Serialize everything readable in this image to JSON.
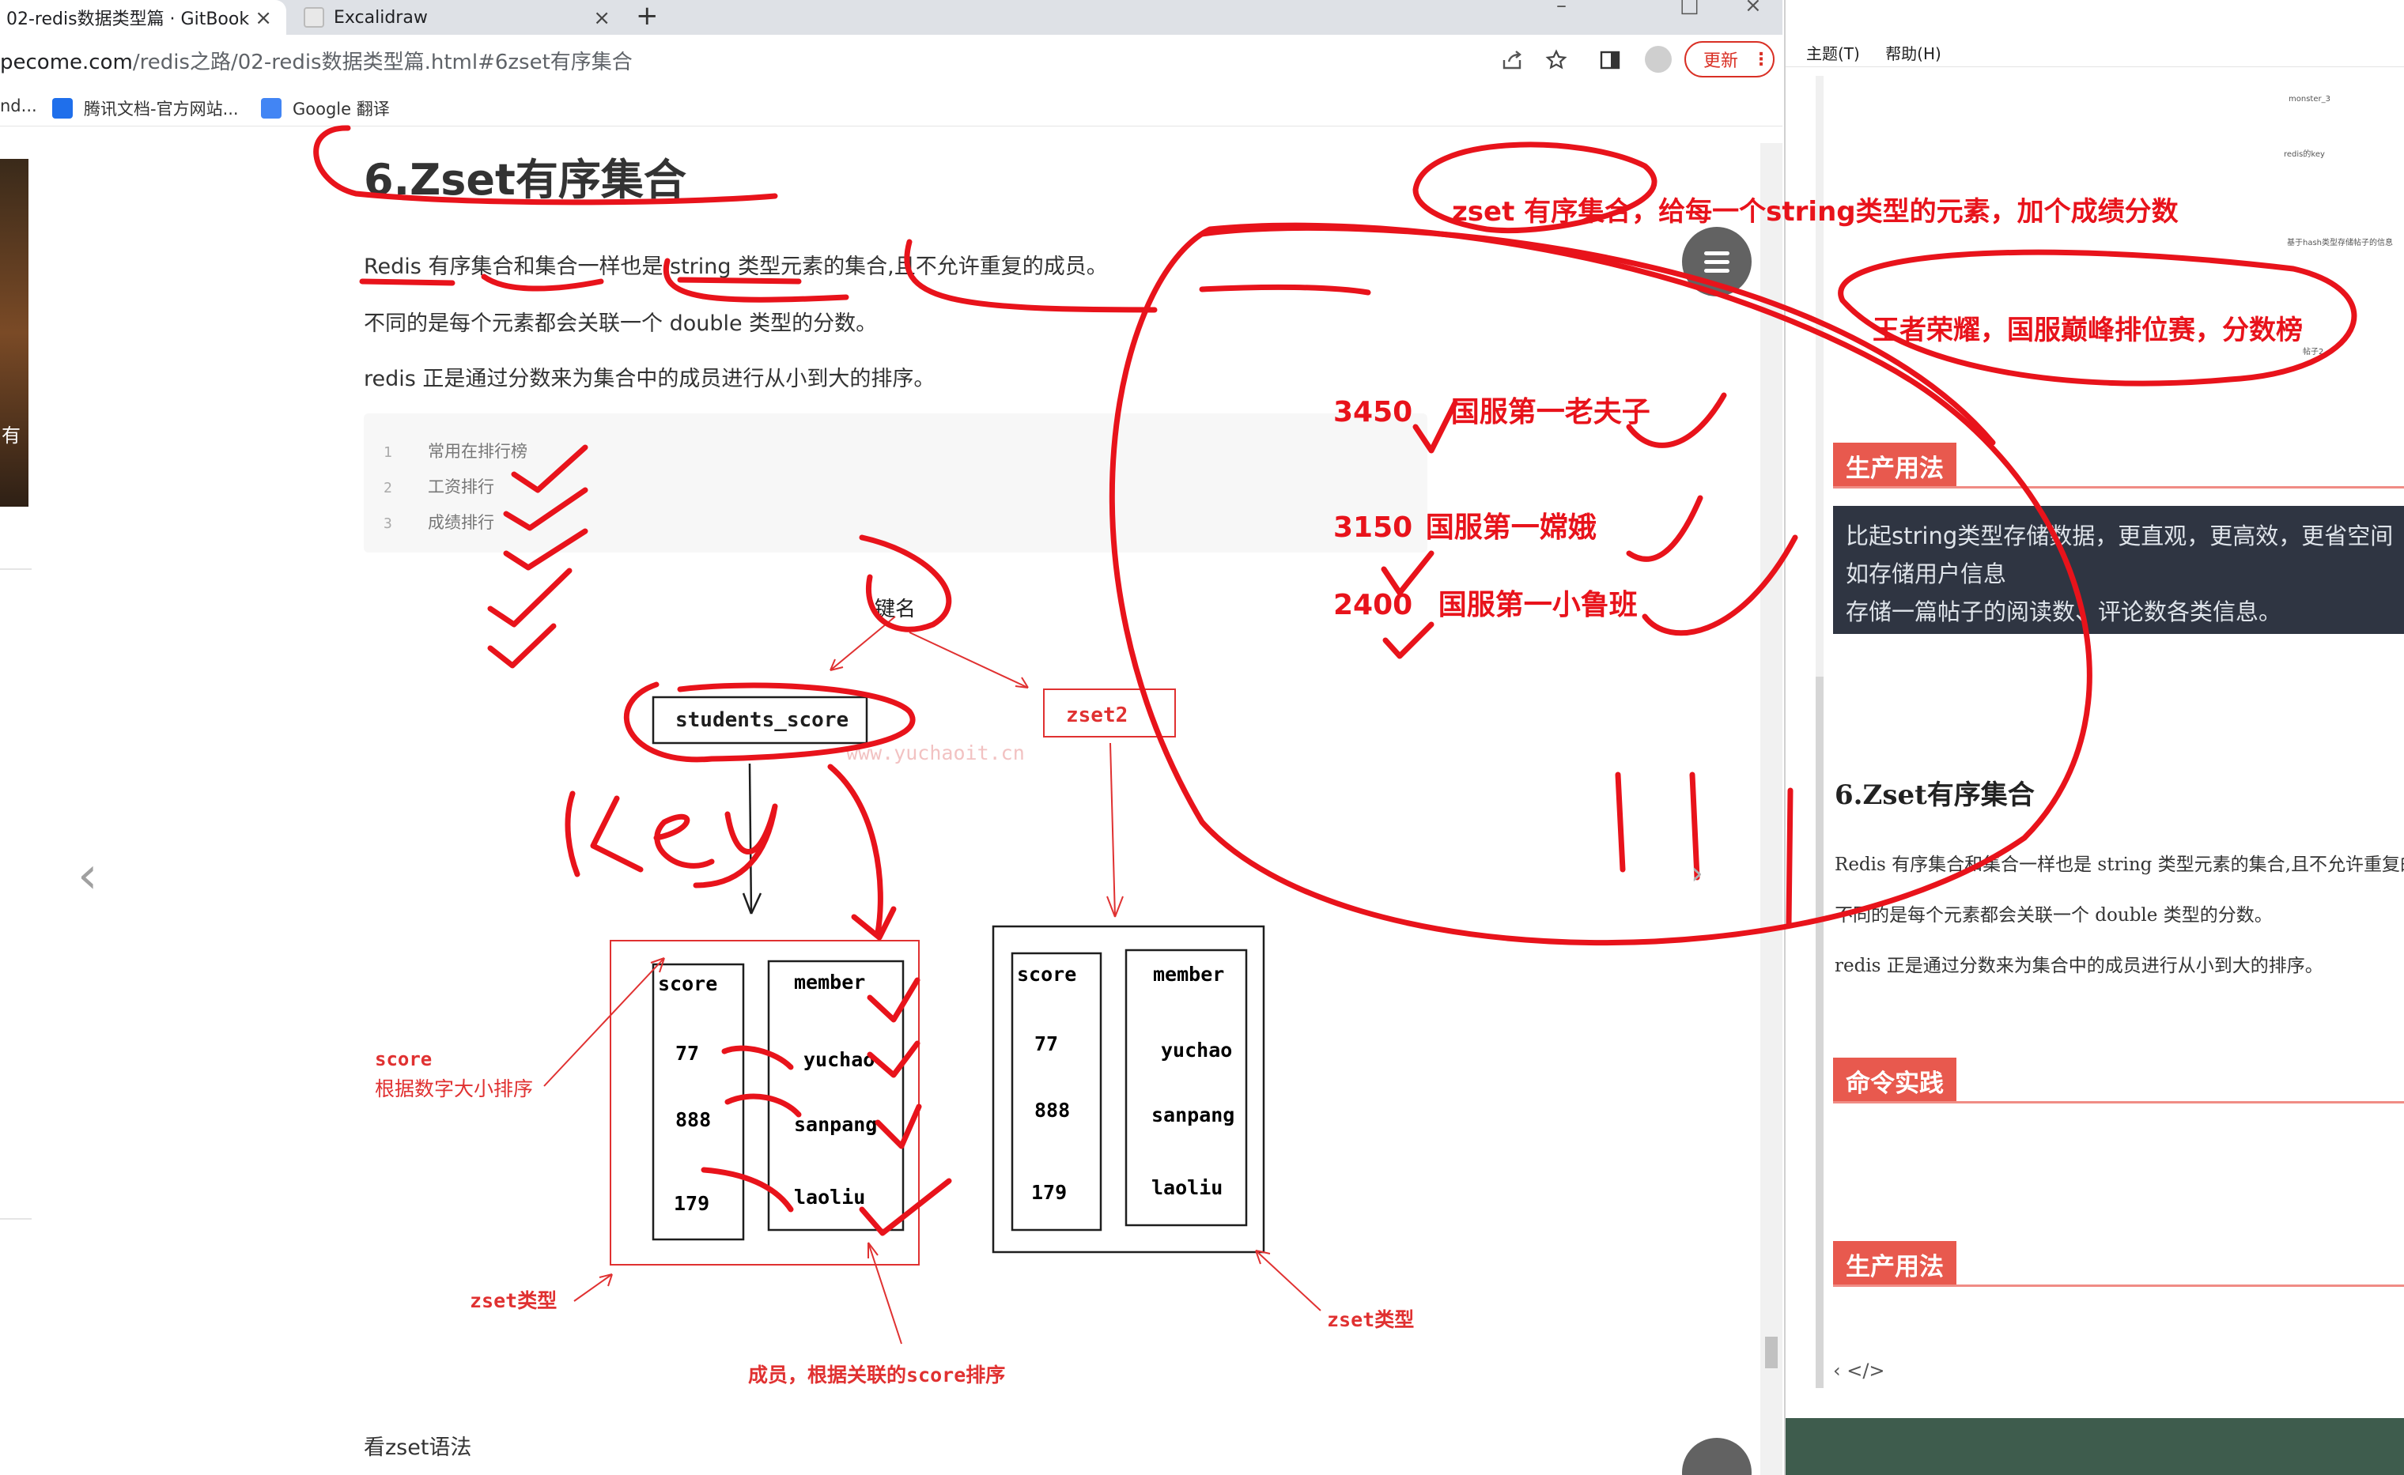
{
  "browser": {
    "tabs": [
      {
        "title": "02-redis数据类型篇 · GitBook",
        "close": "×"
      },
      {
        "title": "Excalidraw",
        "close": "×"
      }
    ],
    "new_tab": "+",
    "window_controls": {
      "minimize": "–",
      "maximize": "□",
      "close": "×"
    },
    "url_prefix": "pecome.com",
    "url_path": "/redis之路/02-redis数据类型篇.html#6zset有序集合",
    "update_button": "更新",
    "menu_dots": "⋮",
    "bookmarks": [
      {
        "label": "nd..."
      },
      {
        "label": "腾讯文档-官方网站..."
      },
      {
        "label": "Google 翻译"
      }
    ],
    "icons": [
      "share-icon",
      "star-icon",
      "sidebar-icon",
      "profile-icon"
    ]
  },
  "page": {
    "left_thumb_text": "有",
    "prev_arrow": "‹",
    "next_arrow": "›",
    "title": "6.Zset有序集合",
    "p1": "Redis 有序集合和集合一样也是 string 类型元素的集合,且不允许重复的成员。",
    "p2": "不同的是每个元素都会关联一个 double 类型的分数。",
    "p3": "redis 正是通过分数来为集合中的成员进行从小到大的排序。",
    "code_lines": [
      {
        "num": "1",
        "text": "常用在排行榜"
      },
      {
        "num": "2",
        "text": "工资排行"
      },
      {
        "num": "3",
        "text": "成绩排行"
      }
    ],
    "bottom_text": "看zset语法"
  },
  "diagram": {
    "key_name_label": "键名",
    "key1": "students_score",
    "key2": "zset2",
    "handwritten_key": "key",
    "watermark": "www.yuchaoit.cn",
    "zset1": {
      "score_header": "score",
      "member_header": "member",
      "scores": [
        "77",
        "888",
        "179"
      ],
      "members": [
        "yuchao",
        "sanpang",
        "laoliu"
      ]
    },
    "zset2": {
      "score_header": "score",
      "member_header": "member",
      "scores": [
        "77",
        "888",
        "179"
      ],
      "members": [
        "yuchao",
        "sanpang",
        "laoliu"
      ]
    },
    "score_note_1": "score",
    "score_note_2": "根据数字大小排序",
    "zset_type_1": "zset类型",
    "zset_type_2": "zset类型",
    "member_note": "成员，根据关联的score排序"
  },
  "annotations": {
    "headline": "zset 有序集合，给每一个string类型的元素，加个成绩分数",
    "example": "王者荣耀，国服巅峰排位赛，分数榜",
    "rankings": [
      {
        "score": "3450",
        "name": "国服第一老夫子"
      },
      {
        "score": "3150",
        "name": "国服第一嫦娥"
      },
      {
        "score": "2400",
        "name": "国服第一小鲁班"
      }
    ]
  },
  "right_panel": {
    "menu": [
      "主题(T)",
      "帮助(H)"
    ],
    "tiny_labels": [
      "monster_3",
      "redis的key",
      "基于hash类型存储帖子的信息",
      "帖子2"
    ],
    "heading_usage": "生产用法",
    "dark_lines": [
      "比起string类型存储数据，更直观，更高效，更省空间",
      "如存储用户信息",
      "存储一篇帖子的阅读数、评论数各类信息。"
    ],
    "section_title": "6.Zset有序集合",
    "p1": "Redis 有序集合和集合一样也是 string 类型元素的集合,且不允许重复的成员。",
    "p2": "不同的是每个元素都会关联一个 double 类型的分数。",
    "p3": "redis 正是通过分数来为集合中的成员进行从小到大的排序。",
    "heading_cmd": "命令实践",
    "heading_usage_2": "生产用法",
    "bottom_icons": "‹   </>"
  },
  "colors": {
    "annotation_red": "#e8131b",
    "diagram_red": "#e03131",
    "tag_red": "#e8594e",
    "dark_box": "#2f3542"
  }
}
